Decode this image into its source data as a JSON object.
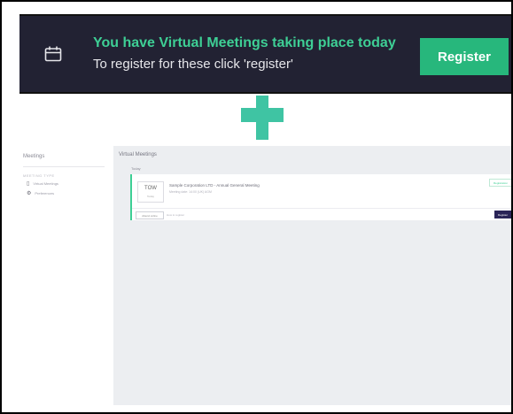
{
  "banner": {
    "icon": "calendar-icon",
    "title": "You have Virtual Meetings taking place today",
    "subtitle": "To register for these click 'register'",
    "register_label": "Register",
    "colors": {
      "background": "#222233",
      "title": "#3ecf95",
      "button": "#27b77c"
    }
  },
  "connector": {
    "icon": "plus-icon",
    "color": "#3fc4a3"
  },
  "sidebar": {
    "title": "Meetings",
    "section_label": "MEETING TYPE",
    "items": [
      {
        "icon": "calendar-icon",
        "label": "Virtual Meetings"
      },
      {
        "icon": "gear-icon",
        "label": "Preferences"
      }
    ]
  },
  "main": {
    "title": "Virtual Meetings",
    "day_label": "Today",
    "meeting": {
      "date_day": "TOW",
      "date_sub": "Today",
      "name": "Sample Corporation LTD - Annual General Meeting",
      "meta": "Meeting date: 14:00 (UK) AGM",
      "status_badge": "Registration",
      "tag_label": "Attend online",
      "help_text": "How to register",
      "register_label": "Register"
    }
  }
}
